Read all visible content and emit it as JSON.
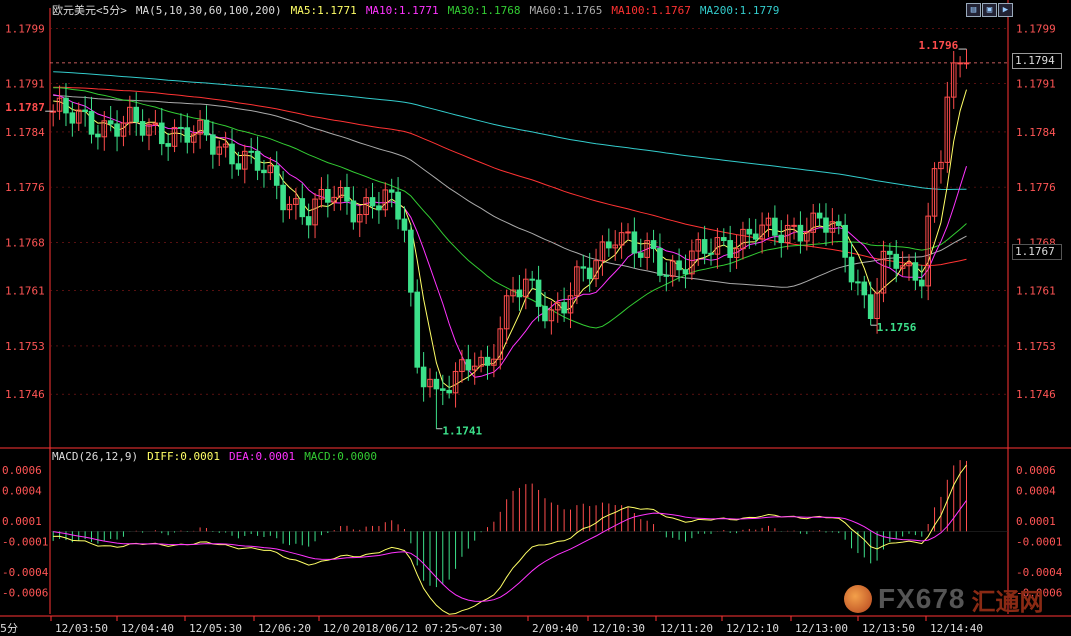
{
  "header": {
    "symbol": "欧元美元<5分>",
    "indicator": "MA(5,10,30,60,100,200)",
    "ma": [
      {
        "label": "MA5:1.1771",
        "color": "#ffff66"
      },
      {
        "label": "MA10:1.1771",
        "color": "#ff33ff"
      },
      {
        "label": "MA30:1.1768",
        "color": "#33cc33"
      },
      {
        "label": "MA60:1.1765",
        "color": "#aaaaaa"
      },
      {
        "label": "MA100:1.1767",
        "color": "#ff3333"
      },
      {
        "label": "MA200:1.1779",
        "color": "#33cccc"
      }
    ]
  },
  "macd_header": {
    "title": "MACD(26,12,9)",
    "items": [
      {
        "label": "DIFF:0.0001",
        "color": "#ffff66"
      },
      {
        "label": "DEA:0.0001",
        "color": "#ff33ff"
      },
      {
        "label": "MACD:0.0000",
        "color": "#33cc33"
      }
    ]
  },
  "current_price": "1.1794",
  "ma100_price": "1.1767",
  "period_label": "5分",
  "time_tooltip": "2018/06/12  07:25～07:30",
  "watermark": {
    "text1": "FX678",
    "text2": "汇通网"
  },
  "chart_data": {
    "type": "candlestick",
    "price_ylim": [
      1.17385,
      1.18005
    ],
    "price_ticks": [
      "1.1799",
      "1.1791",
      "1.1784",
      "1.1776",
      "1.1768",
      "1.1761",
      "1.1753",
      "1.1746"
    ],
    "macd_ylim": [
      -0.00081,
      0.00068
    ],
    "macd_ticks": [
      "0.0006",
      "0.0004",
      "0.0001",
      "-0.0001",
      "-0.0004",
      "-0.0006"
    ],
    "x_labels": [
      "12/03:50",
      "12/04:40",
      "12/05:30",
      "12/06:20",
      "12/0",
      "2/09:40",
      "12/10:30",
      "12/11:20",
      "12/12:10",
      "12/13:00",
      "12/13:50",
      "12/14:40"
    ],
    "annotations": [
      {
        "text": "1.1787",
        "price": 1.1787,
        "candle": 0,
        "color": "#ff4d4d"
      },
      {
        "text": "1.1741",
        "price": 1.1741,
        "candle": 60,
        "color": "#3ce08a"
      },
      {
        "text": "1.1756",
        "price": 1.1756,
        "candle": 128,
        "color": "#3ce08a"
      },
      {
        "text": "1.1796",
        "price": 1.1796,
        "candle": 143,
        "color": "#ff4d4d"
      }
    ],
    "close_anchors": [
      [
        0,
        1.1787
      ],
      [
        3,
        1.1786
      ],
      [
        8,
        1.1785
      ],
      [
        12,
        1.1785
      ],
      [
        18,
        1.1784
      ],
      [
        24,
        1.1783
      ],
      [
        28,
        1.1781
      ],
      [
        32,
        1.1779
      ],
      [
        36,
        1.1775
      ],
      [
        40,
        1.1772
      ],
      [
        44,
        1.1775
      ],
      [
        48,
        1.1773
      ],
      [
        52,
        1.1774
      ],
      [
        55,
        1.1771
      ],
      [
        56,
        1.176
      ],
      [
        57,
        1.175
      ],
      [
        59,
        1.1749
      ],
      [
        60,
        1.1745
      ],
      [
        62,
        1.1747
      ],
      [
        64,
        1.1749
      ],
      [
        66,
        1.1752
      ],
      [
        68,
        1.175
      ],
      [
        70,
        1.1756
      ],
      [
        72,
        1.176
      ],
      [
        74,
        1.1762
      ],
      [
        76,
        1.176
      ],
      [
        78,
        1.1758
      ],
      [
        80,
        1.1759
      ],
      [
        82,
        1.1762
      ],
      [
        84,
        1.1764
      ],
      [
        86,
        1.1767
      ],
      [
        88,
        1.177
      ],
      [
        90,
        1.1768
      ],
      [
        92,
        1.1766
      ],
      [
        94,
        1.1766
      ],
      [
        96,
        1.1764
      ],
      [
        98,
        1.1765
      ],
      [
        100,
        1.1766
      ],
      [
        104,
        1.1767
      ],
      [
        106,
        1.1768
      ],
      [
        108,
        1.1769
      ],
      [
        110,
        1.177
      ],
      [
        112,
        1.1769
      ],
      [
        114,
        1.1769
      ],
      [
        116,
        1.177
      ],
      [
        118,
        1.1771
      ],
      [
        120,
        1.1771
      ],
      [
        122,
        1.177
      ],
      [
        124,
        1.1766
      ],
      [
        126,
        1.1762
      ],
      [
        127,
        1.176
      ],
      [
        128,
        1.1759
      ],
      [
        130,
        1.1765
      ],
      [
        132,
        1.1765
      ],
      [
        134,
        1.1763
      ],
      [
        135,
        1.1763
      ],
      [
        136,
        1.1764
      ],
      [
        137,
        1.1772
      ],
      [
        138,
        1.1778
      ],
      [
        139,
        1.1781
      ],
      [
        140,
        1.179
      ],
      [
        141,
        1.1794
      ]
    ],
    "series": [
      {
        "name": "MA5",
        "color": "#ffff66"
      },
      {
        "name": "MA10",
        "color": "#ff33ff"
      },
      {
        "name": "MA30",
        "color": "#33cc33"
      },
      {
        "name": "MA60",
        "color": "#aaaaaa"
      },
      {
        "name": "MA100",
        "color": "#ff3333"
      },
      {
        "name": "MA200",
        "color": "#33cccc"
      },
      {
        "name": "DIFF",
        "color": "#ffff66"
      },
      {
        "name": "DEA",
        "color": "#ff33ff"
      },
      {
        "name": "MACD",
        "color": "#ff4d4d"
      }
    ],
    "colors": {
      "up": "#ff4d4d",
      "down": "#3ce08a",
      "grid": "#8b1a1a",
      "axis": "#ff3333"
    }
  }
}
